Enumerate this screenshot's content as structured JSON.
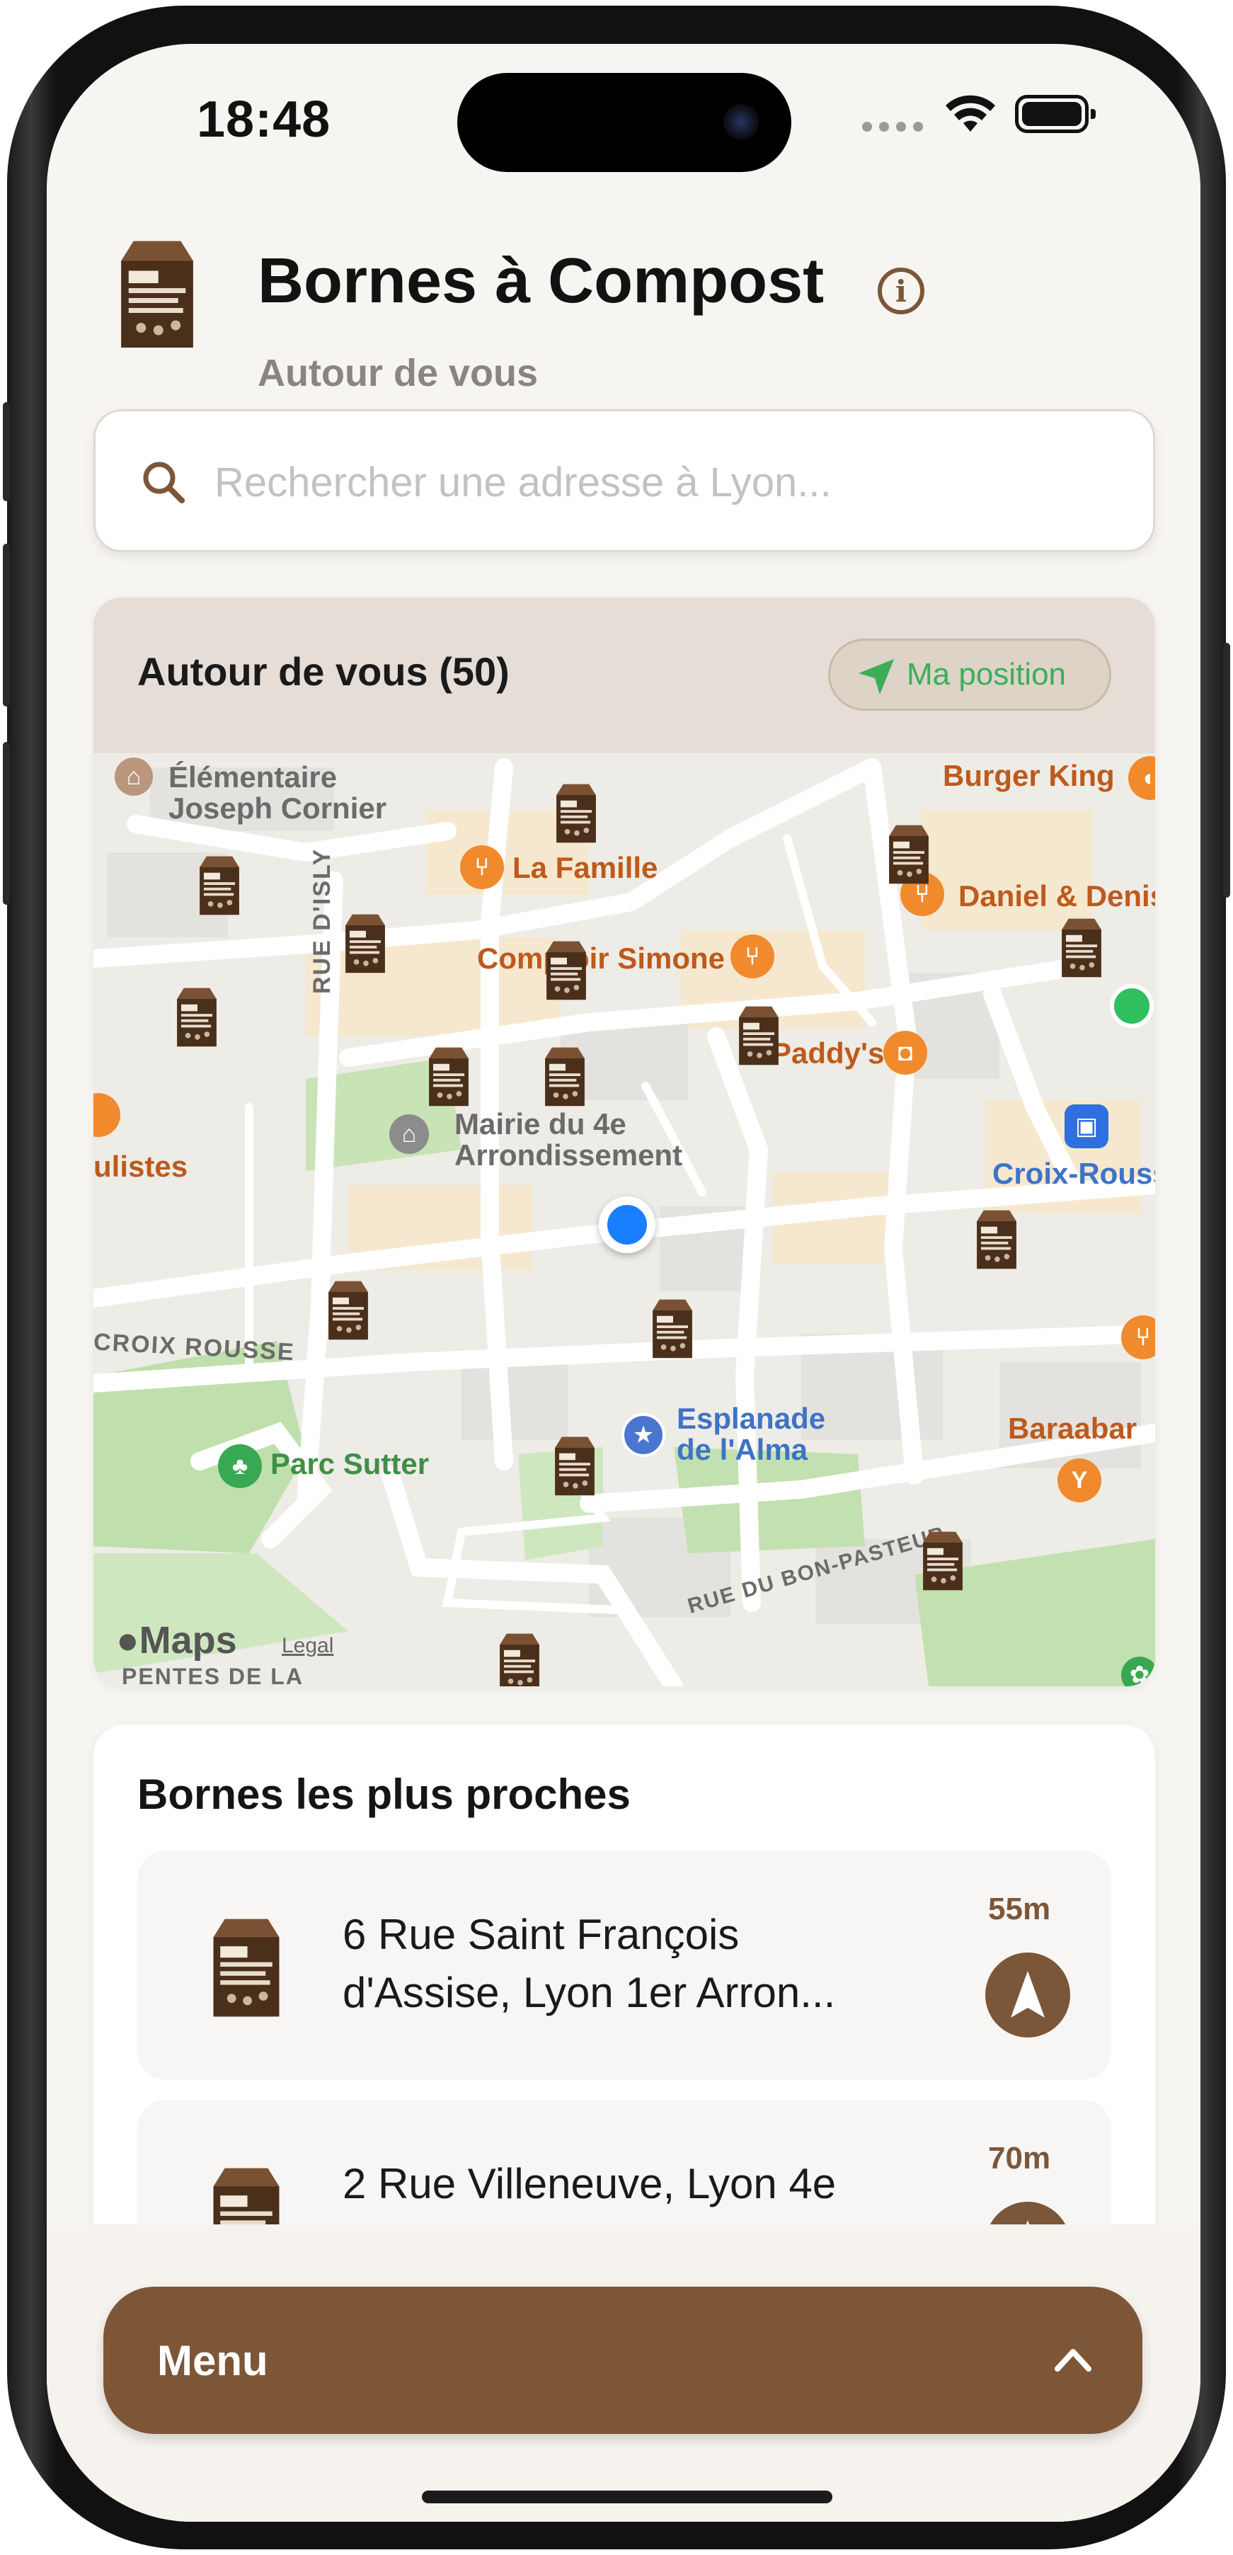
{
  "status_bar": {
    "time": "18:48"
  },
  "header": {
    "title": "Bornes à Compost",
    "subtitle": "Autour de vous"
  },
  "search": {
    "placeholder": "Rechercher une adresse à Lyon..."
  },
  "map_card": {
    "title": "Autour de vous (50)",
    "position_button": "Ma position",
    "attribution": "Maps",
    "legal": "Legal",
    "labels": {
      "ecole": "Élémentaire",
      "ecole2": "Joseph Cornier",
      "famille": "La Famille",
      "burger": "Burger King",
      "daniel": "Daniel & Denis",
      "comptoir": "Comptoir Simone",
      "paddys": "Paddy's",
      "rue_isly": "RUE D'ISLY",
      "mairie": "Mairie du 4e",
      "mairie2": "Arrondissement",
      "ulistes": "ulistes",
      "croix_rousse": "Croix-Rousse",
      "croix_rousse_street": "CROIX ROUSSE",
      "esplanade": "Esplanade",
      "esplanade2": "de l'Alma",
      "parc": "Parc Sutter",
      "baraabar": "Baraabar",
      "bon_pasteur": "RUE DU BON-PASTEUR",
      "pentes": "PENTES DE LA"
    }
  },
  "nearest": {
    "title": "Bornes les plus proches",
    "items": [
      {
        "address": "6 Rue Saint François d'Assise, Lyon 1er Arron...",
        "distance": "55m"
      },
      {
        "address": "2 Rue Villeneuve, Lyon 4e",
        "distance": "70m"
      }
    ]
  },
  "menu": {
    "label": "Menu"
  },
  "colors": {
    "accent": "#7d5638",
    "background": "#f7f5f1",
    "location_green": "#3cae58",
    "user_dot": "#1a7fff"
  }
}
